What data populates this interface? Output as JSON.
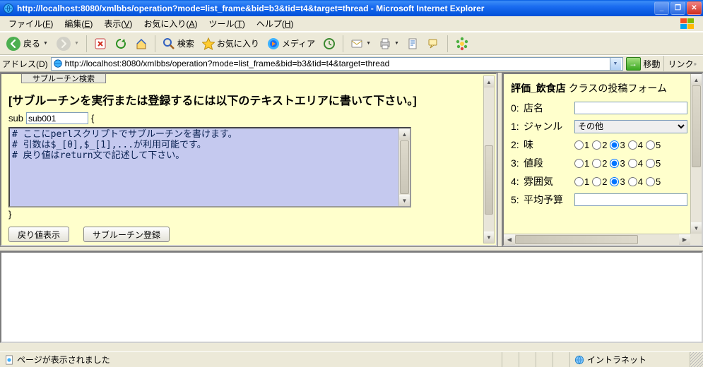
{
  "window": {
    "title": "http://localhost:8080/xmlbbs/operation?mode=list_frame&bid=b3&tid=t4&target=thread - Microsoft Internet Explorer"
  },
  "menubar": {
    "items": [
      {
        "label": "ファイル",
        "accel": "F"
      },
      {
        "label": "編集",
        "accel": "E"
      },
      {
        "label": "表示",
        "accel": "V"
      },
      {
        "label": "お気に入り",
        "accel": "A"
      },
      {
        "label": "ツール",
        "accel": "T"
      },
      {
        "label": "ヘルプ",
        "accel": "H"
      }
    ]
  },
  "toolbar": {
    "back": "戻る",
    "search": "検索",
    "favorites": "お気に入り",
    "media": "メディア"
  },
  "addressbar": {
    "label": "アドレス(D)",
    "url": "http://localhost:8080/xmlbbs/operation?mode=list_frame&bid=b3&tid=t4&target=thread",
    "go": "移動",
    "links": "リンク"
  },
  "left": {
    "tab_partial": "サブルーチン検索",
    "heading": "[サブルーチンを実行または登録するには以下のテキストエリアに書いて下さい。]",
    "sub_keyword": "sub",
    "sub_name": "sub001",
    "brace_open": "{",
    "brace_close": "}",
    "textarea": "# ここにperlスクリプトでサブルーチンを書けます。\n# 引数は$_[0],$_[1],...が利用可能です。\n# 戻り値はreturn文で記述して下さい。",
    "btn_return": "戻り値表示",
    "btn_register": "サブルーチン登録"
  },
  "right": {
    "heading_bold": "評価_飲食店",
    "heading_rest": " クラスの投稿フォーム",
    "rows": [
      {
        "idx": "0:",
        "label": "店名",
        "type": "text",
        "value": ""
      },
      {
        "idx": "1:",
        "label": "ジャンル",
        "type": "select",
        "value": "その他"
      },
      {
        "idx": "2:",
        "label": "味",
        "type": "radio",
        "selected": 3
      },
      {
        "idx": "3:",
        "label": "値段",
        "type": "radio",
        "selected": 3
      },
      {
        "idx": "4:",
        "label": "雰囲気",
        "type": "radio",
        "selected": 3
      },
      {
        "idx": "5:",
        "label": "平均予算",
        "type": "text",
        "value": ""
      }
    ],
    "radio_options": [
      "1",
      "2",
      "3",
      "4",
      "5"
    ]
  },
  "statusbar": {
    "message": "ページが表示されました",
    "zone": "イントラネット"
  }
}
